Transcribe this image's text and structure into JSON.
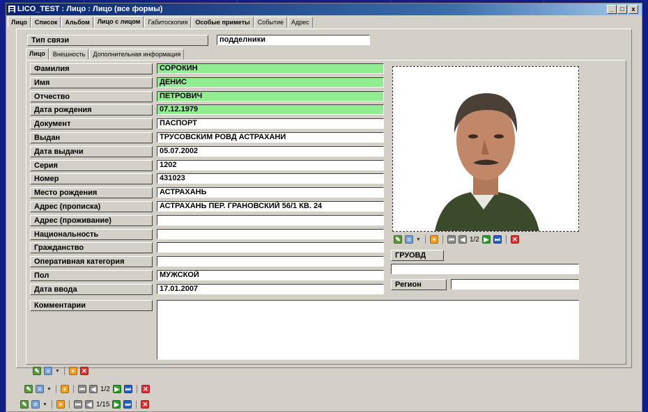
{
  "window": {
    "title": "LICO_TEST : Лицо : Лицо (все формы)",
    "min": "_",
    "max": "□",
    "close": "x"
  },
  "tabs": [
    "Лицо",
    "Список",
    "Альбом",
    "Лицо с лицом",
    "Габитоскопия",
    "Особые приметы",
    "Событие",
    "Адрес"
  ],
  "link": {
    "label": "Тип связи",
    "value": "подделники"
  },
  "subtabs": [
    "Лицо",
    "Внешность",
    "Дополнительная информация"
  ],
  "fields": [
    {
      "label": "Фамилия",
      "value": "СОРОКИН"
    },
    {
      "label": "Имя",
      "value": "ДЕНИС"
    },
    {
      "label": "Отчество",
      "value": "ПЕТРОВИЧ"
    },
    {
      "label": "Дата рождения",
      "value": "07.12.1979"
    },
    {
      "label": "Документ",
      "value": "ПАСПОРТ"
    },
    {
      "label": "Выдан",
      "value": "ТРУСОВСКИМ РОВД АСТРАХАНИ"
    },
    {
      "label": "Дата выдачи",
      "value": "05.07.2002"
    },
    {
      "label": "Серия",
      "value": "1202"
    },
    {
      "label": "Номер",
      "value": "431023"
    },
    {
      "label": "Место рождения",
      "value": "АСТРАХАНЬ"
    },
    {
      "label": "Адрес (прописка)",
      "value": "АСТРАХАНЬ ПЕР. ГРАНОВСКИЙ 56/1 КВ. 24"
    },
    {
      "label": "Адрес (проживание)",
      "value": ""
    },
    {
      "label": "Национальность",
      "value": ""
    },
    {
      "label": "Гражданство",
      "value": ""
    },
    {
      "label": "Оперативная категория",
      "value": ""
    },
    {
      "label": "Пол",
      "value": "МУЖСКОЙ"
    },
    {
      "label": "Дата ввода",
      "value": "17.01.2007"
    }
  ],
  "comments": {
    "label": "Комментарии",
    "value": ""
  },
  "photo_nav": {
    "counter": "1/2"
  },
  "gruovd": {
    "label": "ГРУОВД",
    "value": ""
  },
  "region": {
    "label": "Регион",
    "value": ""
  },
  "nav_mid": {
    "counter": "1/2"
  },
  "nav_bottom": {
    "counter": "1/15"
  },
  "colors": {
    "green_field": "#90ee90",
    "desktop": "#0f1f86"
  }
}
